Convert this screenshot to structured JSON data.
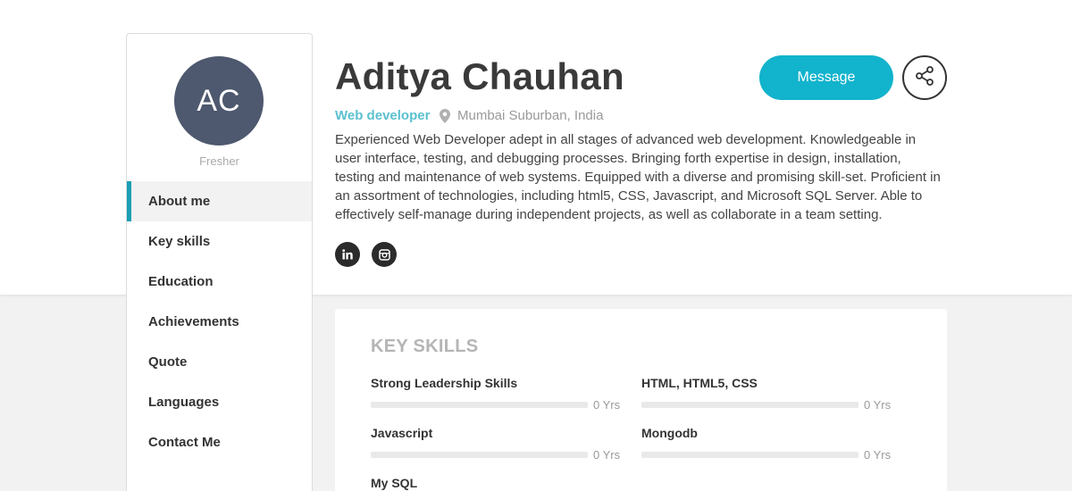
{
  "profile": {
    "initials": "AC",
    "status": "Fresher",
    "name": "Aditya Chauhan",
    "role": "Web developer",
    "location": "Mumbai Suburban, India",
    "bio": "Experienced Web Developer adept in all stages of advanced web development. Knowledgeable in user interface, testing, and debugging processes. Bringing forth expertise in design, installation, testing and maintenance of web systems. Equipped with a diverse and promising skill-set. Proficient in an assortment of technologies, including html5, CSS, Javascript, and Microsoft SQL Server. Able to effectively self-manage during independent projects, as well as collaborate in a team setting."
  },
  "actions": {
    "message_label": "Message",
    "share_icon": "share-icon"
  },
  "socials": [
    {
      "name": "linkedin-icon",
      "glyph": "in"
    },
    {
      "name": "instagram-icon",
      "glyph": "instagram"
    }
  ],
  "nav": {
    "active_index": 0,
    "items": [
      {
        "label": "About me"
      },
      {
        "label": "Key skills"
      },
      {
        "label": "Education"
      },
      {
        "label": "Achievements"
      },
      {
        "label": "Quote"
      },
      {
        "label": "Languages"
      },
      {
        "label": "Contact Me"
      }
    ]
  },
  "skills": {
    "title": "KEY SKILLS",
    "items": [
      {
        "name": "Strong Leadership Skills",
        "years": "0 Yrs",
        "level": 0
      },
      {
        "name": "HTML, HTML5, CSS",
        "years": "0 Yrs",
        "level": 0
      },
      {
        "name": "Javascript",
        "years": "0 Yrs",
        "level": 0
      },
      {
        "name": "Mongodb",
        "years": "0 Yrs",
        "level": 0
      },
      {
        "name": "My SQL",
        "years": "",
        "level": 0
      }
    ]
  },
  "colors": {
    "accent": "#12b3cc",
    "role_text": "#5bc0cf",
    "avatar_bg": "#4e586e",
    "active_border": "#1a9fb3"
  }
}
